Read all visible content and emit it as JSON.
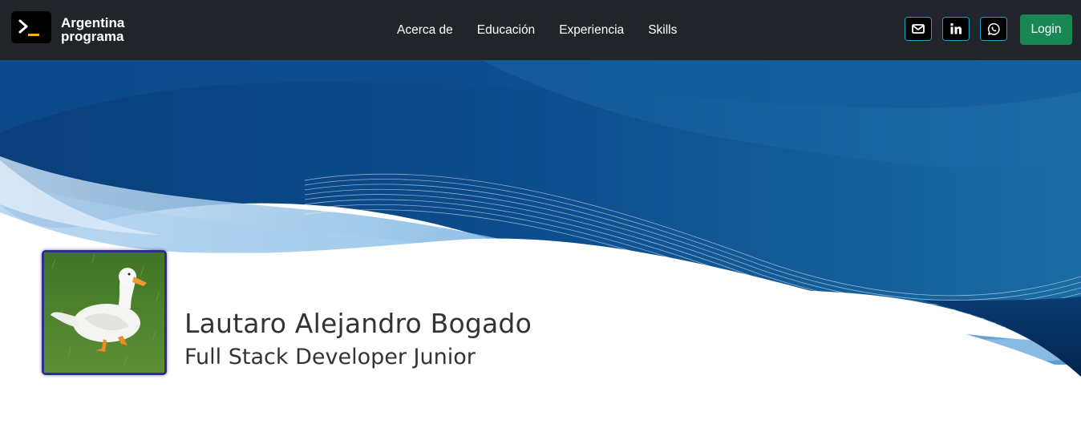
{
  "brand": {
    "line1": "Argentina",
    "line2": "programa",
    "logo_icon": "terminal-prompt-icon"
  },
  "nav": {
    "links": [
      {
        "label": "Acerca de"
      },
      {
        "label": "Educación"
      },
      {
        "label": "Experiencia"
      },
      {
        "label": "Skills"
      }
    ]
  },
  "social": {
    "email_icon": "envelope-icon",
    "linkedin_icon": "linkedin-icon",
    "whatsapp_icon": "whatsapp-icon"
  },
  "login": {
    "label": "Login"
  },
  "profile": {
    "name": "Lautaro Alejandro Bogado",
    "role": "Full Stack Developer Junior",
    "photo": "white-duck-on-grass"
  },
  "colors": {
    "navbar": "#212529",
    "login": "#198754",
    "banner_dark": "#0b3f7a",
    "banner_light": "#8fc3ea",
    "text": "#333333"
  }
}
